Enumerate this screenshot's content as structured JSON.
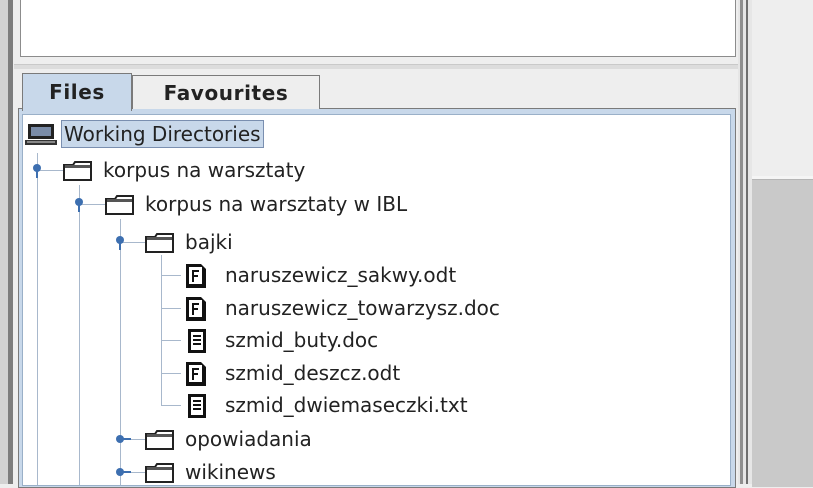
{
  "tabs": [
    {
      "label": "Files",
      "selected": true
    },
    {
      "label": "Favourites",
      "selected": false
    }
  ],
  "tree": {
    "root": {
      "label": "Working Directories",
      "icon": "computer-icon"
    },
    "nodes": [
      {
        "label": "korpus na warsztaty",
        "type": "folder",
        "expanded": true
      },
      {
        "label": "korpus na warsztaty w IBL",
        "type": "folder",
        "expanded": true
      },
      {
        "label": "bajki",
        "type": "folder",
        "expanded": true
      },
      {
        "label": "naruszewicz_sakwy.odt",
        "type": "file",
        "icon": "formatted-file-icon"
      },
      {
        "label": "naruszewicz_towarzysz.doc",
        "type": "file",
        "icon": "formatted-file-icon"
      },
      {
        "label": "szmid_buty.doc",
        "type": "file",
        "icon": "text-file-icon"
      },
      {
        "label": "szmid_deszcz.odt",
        "type": "file",
        "icon": "formatted-file-icon"
      },
      {
        "label": "szmid_dwiemaseczki.txt",
        "type": "file",
        "icon": "text-file-icon"
      },
      {
        "label": "opowiadania",
        "type": "folder",
        "expanded": false
      },
      {
        "label": "wikinews",
        "type": "folder",
        "expanded": false
      }
    ]
  },
  "colors": {
    "selection": "#c8d8ea",
    "tree_line": "#a8b8cc",
    "handle": "#3d6fb0"
  }
}
